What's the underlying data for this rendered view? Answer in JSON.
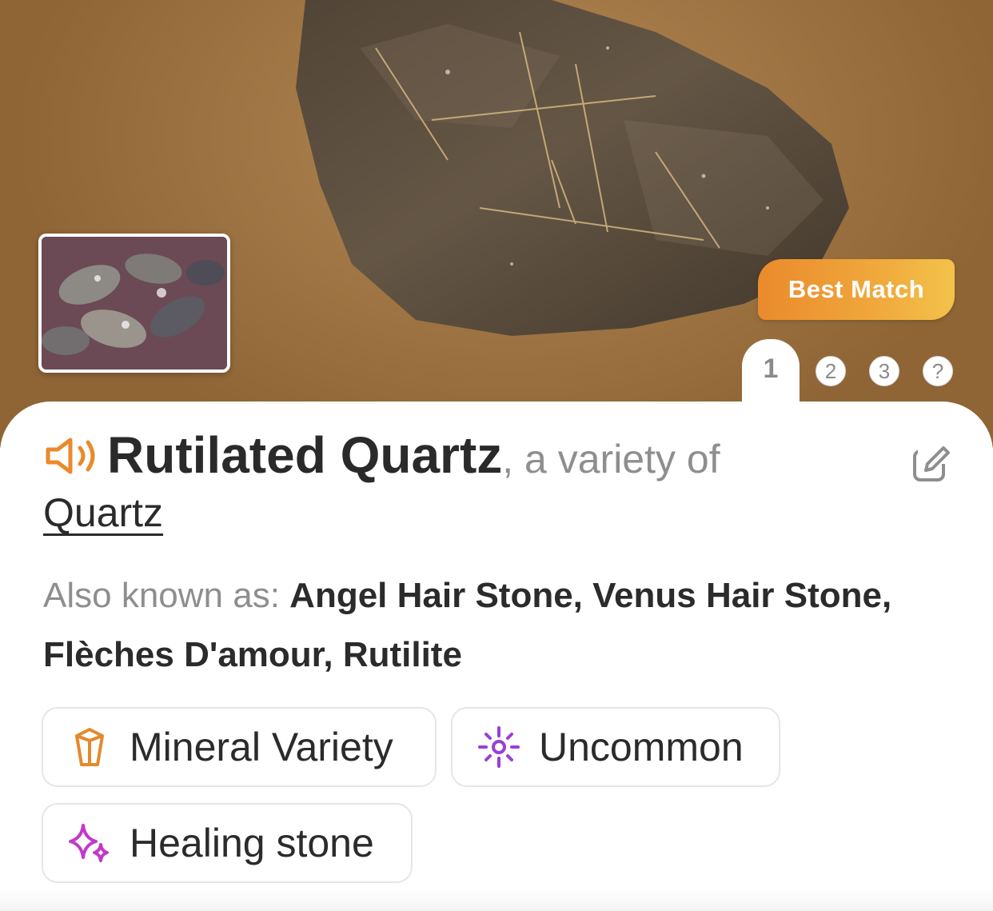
{
  "hero": {
    "best_match_label": "Best Match",
    "pages": [
      "1",
      "2",
      "3",
      "?"
    ],
    "active_page": "1"
  },
  "result": {
    "name": "Rutilated Quartz",
    "variety_text": ", a variety of",
    "parent": "Quartz",
    "aka_label": "Also known as:",
    "aka_value": "Angel Hair Stone, Venus Hair Stone, Flèches D'amour, Rutilite"
  },
  "tags": [
    {
      "label": "Mineral Variety",
      "icon": "crystal-icon",
      "color": "#e38a2d"
    },
    {
      "label": "Uncommon",
      "icon": "sparkle-burst-icon",
      "color": "#9b3fd6"
    },
    {
      "label": "Healing stone",
      "icon": "sparkles-icon",
      "color": "#c13ac9"
    }
  ],
  "colors": {
    "accent_orange": "#ea8a2c",
    "title_text": "#2a2a2a",
    "muted_text": "#8e8e8e"
  }
}
